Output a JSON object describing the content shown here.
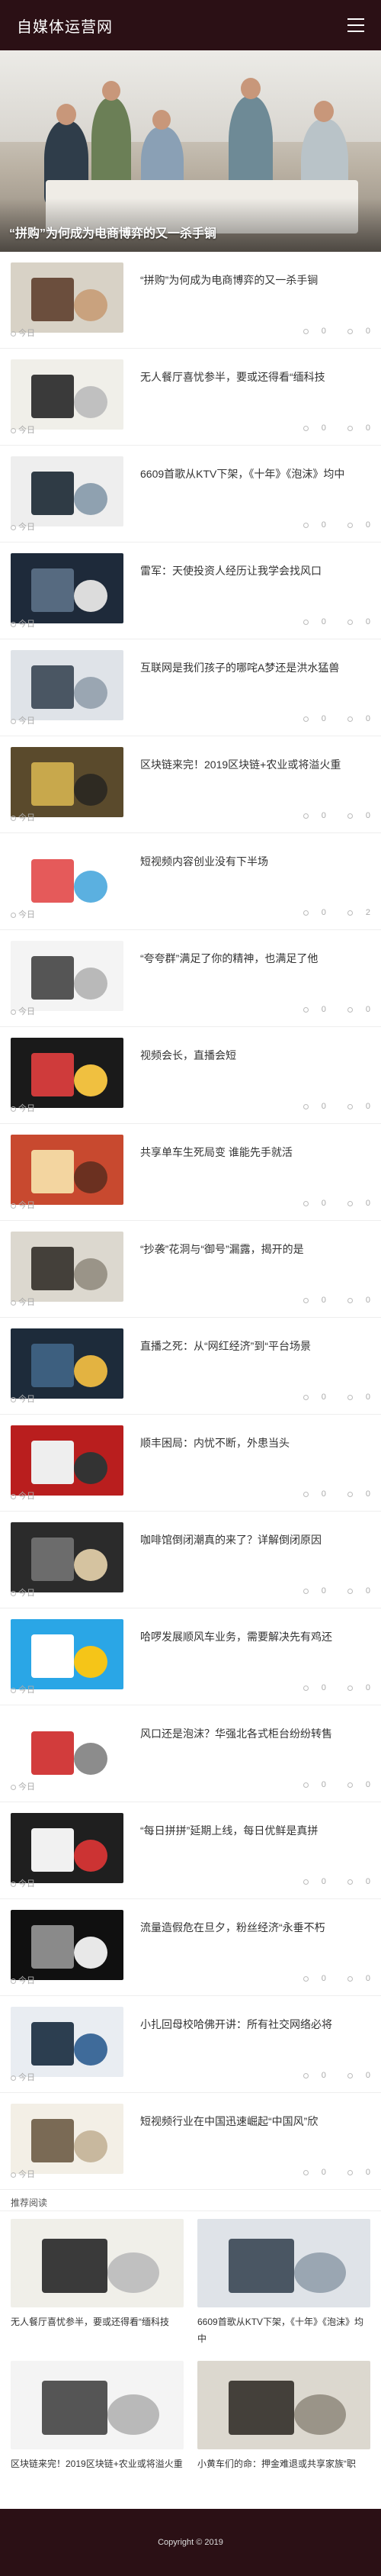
{
  "site": {
    "title": "自媒体运营网"
  },
  "hero": {
    "title": "“拼购”为何成为电商博弈的又一杀手锏"
  },
  "articles": [
    {
      "title": "“拼购”为何成为电商博弈的又一杀手锏",
      "date": "今日",
      "views": "0",
      "comments": "0",
      "icon": "image-thumbnail"
    },
    {
      "title": "无人餐厅喜忧参半，要或还得看“缅科技",
      "date": "今日",
      "views": "0",
      "comments": "0",
      "icon": "image-thumbnail"
    },
    {
      "title": "6609首歌从KTV下架，《十年》《泡沫》均中",
      "date": "今日",
      "views": "0",
      "comments": "0",
      "icon": "image-thumbnail"
    },
    {
      "title": "雷军：天使投资人经历让我学会找风口",
      "date": "今日",
      "views": "0",
      "comments": "0",
      "icon": "image-thumbnail"
    },
    {
      "title": "互联网是我们孩子的哪咤A梦还是洪水猛兽",
      "date": "今日",
      "views": "0",
      "comments": "0",
      "icon": "image-thumbnail"
    },
    {
      "title": "区块链来完！2019区块链+农业或将溢火重",
      "date": "今日",
      "views": "0",
      "comments": "0",
      "icon": "image-thumbnail"
    },
    {
      "title": "短视频内容创业没有下半场",
      "date": "今日",
      "views": "0",
      "comments": "2",
      "icon": "image-thumbnail"
    },
    {
      "title": "“夸夸群”满足了你的精神，也满足了他",
      "date": "今日",
      "views": "0",
      "comments": "0",
      "icon": "image-thumbnail"
    },
    {
      "title": "视频会长，直播会短",
      "date": "今日",
      "views": "0",
      "comments": "0",
      "icon": "image-thumbnail"
    },
    {
      "title": "共享单车生死局变 谁能先手就活",
      "date": "今日",
      "views": "0",
      "comments": "0",
      "icon": "image-thumbnail"
    },
    {
      "title": "“抄袭”花洞与“御号”漏露，揭开的是",
      "date": "今日",
      "views": "0",
      "comments": "0",
      "icon": "image-thumbnail"
    },
    {
      "title": "直播之死：从“网红经济”到“平台场景",
      "date": "今日",
      "views": "0",
      "comments": "0",
      "icon": "image-thumbnail"
    },
    {
      "title": "顺丰困局：内忧不断，外患当头",
      "date": "今日",
      "views": "0",
      "comments": "0",
      "icon": "image-thumbnail"
    },
    {
      "title": "咖啡馆倒闭潮真的来了？详解倒闭原因",
      "date": "今日",
      "views": "0",
      "comments": "0",
      "icon": "image-thumbnail"
    },
    {
      "title": "哈啰发展顺风车业务，需要解决先有鸡还",
      "date": "今日",
      "views": "0",
      "comments": "0",
      "icon": "image-thumbnail"
    },
    {
      "title": "风口还是泡沫？华强北各式柜台纷纷转售",
      "date": "今日",
      "views": "0",
      "comments": "0",
      "icon": "image-thumbnail"
    },
    {
      "title": "“每日拼拼”延期上线，每日优鲜是真拼",
      "date": "今日",
      "views": "0",
      "comments": "0",
      "icon": "image-thumbnail"
    },
    {
      "title": "流量造假危在旦夕，粉丝经济“永垂不朽",
      "date": "今日",
      "views": "0",
      "comments": "0",
      "icon": "image-thumbnail"
    },
    {
      "title": "小扎回母校哈佛开讲：所有社交网络必将",
      "date": "今日",
      "views": "0",
      "comments": "0",
      "icon": "image-thumbnail"
    },
    {
      "title": "短视频行业在中国迅速崛起“中国风”欣",
      "date": "今日",
      "views": "0",
      "comments": "0",
      "icon": "image-thumbnail"
    }
  ],
  "recommended": {
    "title": "推荐阅读",
    "items": [
      {
        "title": "无人餐厅喜忧参半，要或还得看“缅科技"
      },
      {
        "title": "6609首歌从KTV下架，《十年》《泡沫》均中"
      },
      {
        "title": "区块链来完！2019区块链+农业或将溢火重"
      },
      {
        "title": "小黄车们的命：押金难退或共享家族“职"
      }
    ]
  },
  "footer": {
    "text": "Copyright © 2019"
  },
  "colors": {
    "header_bg": "#2b1015",
    "footer_bg": "#2b1015"
  }
}
